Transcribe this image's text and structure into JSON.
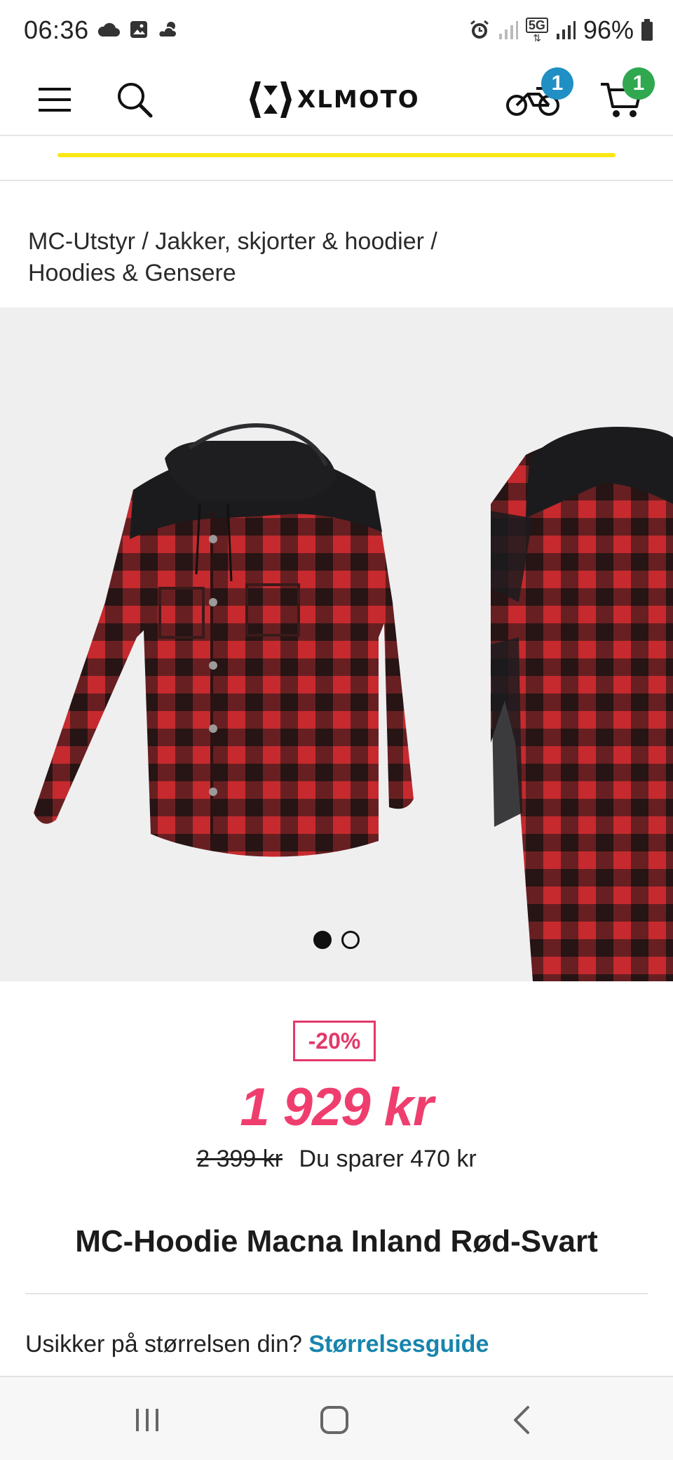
{
  "status_bar": {
    "time": "06:36",
    "battery": "96%",
    "network": "5G",
    "icons": [
      "cloud-icon",
      "image-icon",
      "weather-icon",
      "alarm-icon",
      "signal-icon",
      "battery-icon"
    ]
  },
  "header": {
    "logo_text": "XLMOTO",
    "bike_badge": "1",
    "cart_badge": "1",
    "bike_badge_color": "#1f8fc4",
    "cart_badge_color": "#2fa84f"
  },
  "breadcrumb": {
    "items": [
      "MC-Utstyr",
      "Jakker, skjorter & hoodier",
      "Hoodies & Gensere"
    ],
    "separator": "/"
  },
  "gallery": {
    "slide_count": 2,
    "active_index": 0
  },
  "product": {
    "discount": "-20%",
    "price": "1 929 kr",
    "old_price": "2 399 kr",
    "savings": "Du sparer 470 kr",
    "title": "MC-Hoodie Macna Inland Rød-Svart",
    "size_question": "Usikker på størrelsen din?",
    "size_guide_link": "Størrelsesguide"
  },
  "colors": {
    "accent_pink": "#ef3e6e",
    "link_blue": "#1785ad",
    "progress_yellow": "#fbe715"
  }
}
